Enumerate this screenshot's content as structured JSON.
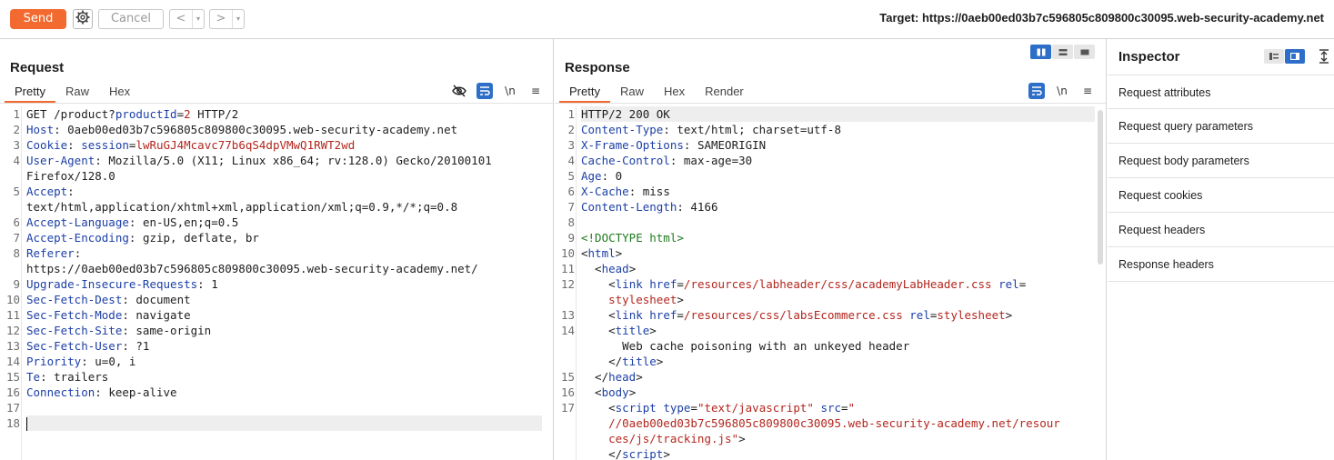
{
  "toolbar": {
    "send_label": "Send",
    "cancel_label": "Cancel",
    "back_label": "<",
    "forward_label": ">",
    "dropdown_glyph": "▾",
    "target_label": "Target: https://0aeb00ed03b7c596805c809800c30095.web-security-academy.net"
  },
  "colors": {
    "accent": "#f26a2f",
    "selected": "#2d6ec8",
    "header_key": "#1c3fa6",
    "string_value": "#b3261e",
    "doctype": "#1e7a1e"
  },
  "request": {
    "title": "Request",
    "tabs": [
      "Pretty",
      "Raw",
      "Hex"
    ],
    "active_tab": "Pretty",
    "icons": [
      "eye-off-icon",
      "wrap-lines-icon",
      "newline-icon",
      "menu-icon"
    ],
    "newline_glyph": "\\n",
    "menu_glyph": "≡",
    "lines": [
      {
        "n": "1",
        "segs": [
          {
            "t": "GET /product?",
            "c": "v"
          },
          {
            "t": "productId",
            "c": "k"
          },
          {
            "t": "=",
            "c": "v"
          },
          {
            "t": "2",
            "c": "r"
          },
          {
            "t": " HTTP/2",
            "c": "v"
          }
        ]
      },
      {
        "n": "2",
        "segs": [
          {
            "t": "Host",
            "c": "k"
          },
          {
            "t": ": 0aeb00ed03b7c596805c809800c30095.web-security-academy.net",
            "c": "v"
          }
        ]
      },
      {
        "n": "3",
        "segs": [
          {
            "t": "Cookie",
            "c": "k"
          },
          {
            "t": ": ",
            "c": "v"
          },
          {
            "t": "session",
            "c": "k"
          },
          {
            "t": "=",
            "c": "v"
          },
          {
            "t": "lwRuGJ4Mcavc77b6qS4dpVMwQ1RWT2wd",
            "c": "r"
          }
        ]
      },
      {
        "n": "4",
        "segs": [
          {
            "t": "User-Agent",
            "c": "k"
          },
          {
            "t": ": Mozilla/5.0 (X11; Linux x86_64; rv:128.0) Gecko/20100101",
            "c": "v"
          }
        ]
      },
      {
        "n": "",
        "segs": [
          {
            "t": "Firefox/128.0",
            "c": "v"
          }
        ]
      },
      {
        "n": "5",
        "segs": [
          {
            "t": "Accept",
            "c": "k"
          },
          {
            "t": ":",
            "c": "v"
          }
        ]
      },
      {
        "n": "",
        "segs": [
          {
            "t": "text/html,application/xhtml+xml,application/xml;q=0.9,*/*;q=0.8",
            "c": "v"
          }
        ]
      },
      {
        "n": "6",
        "segs": [
          {
            "t": "Accept-Language",
            "c": "k"
          },
          {
            "t": ": en-US,en;q=0.5",
            "c": "v"
          }
        ]
      },
      {
        "n": "7",
        "segs": [
          {
            "t": "Accept-Encoding",
            "c": "k"
          },
          {
            "t": ": gzip, deflate, br",
            "c": "v"
          }
        ]
      },
      {
        "n": "8",
        "segs": [
          {
            "t": "Referer",
            "c": "k"
          },
          {
            "t": ":",
            "c": "v"
          }
        ]
      },
      {
        "n": "",
        "segs": [
          {
            "t": "https://0aeb00ed03b7c596805c809800c30095.web-security-academy.net/",
            "c": "v"
          }
        ]
      },
      {
        "n": "9",
        "segs": [
          {
            "t": "Upgrade-Insecure-Requests",
            "c": "k"
          },
          {
            "t": ": 1",
            "c": "v"
          }
        ]
      },
      {
        "n": "10",
        "segs": [
          {
            "t": "Sec-Fetch-Dest",
            "c": "k"
          },
          {
            "t": ": document",
            "c": "v"
          }
        ]
      },
      {
        "n": "11",
        "segs": [
          {
            "t": "Sec-Fetch-Mode",
            "c": "k"
          },
          {
            "t": ": navigate",
            "c": "v"
          }
        ]
      },
      {
        "n": "12",
        "segs": [
          {
            "t": "Sec-Fetch-Site",
            "c": "k"
          },
          {
            "t": ": same-origin",
            "c": "v"
          }
        ]
      },
      {
        "n": "13",
        "segs": [
          {
            "t": "Sec-Fetch-User",
            "c": "k"
          },
          {
            "t": ": ?1",
            "c": "v"
          }
        ]
      },
      {
        "n": "14",
        "segs": [
          {
            "t": "Priority",
            "c": "k"
          },
          {
            "t": ": u=0, i",
            "c": "v"
          }
        ]
      },
      {
        "n": "15",
        "segs": [
          {
            "t": "Te",
            "c": "k"
          },
          {
            "t": ": trailers",
            "c": "v"
          }
        ]
      },
      {
        "n": "16",
        "segs": [
          {
            "t": "Connection",
            "c": "k"
          },
          {
            "t": ": keep-alive",
            "c": "v"
          }
        ]
      },
      {
        "n": "17",
        "segs": []
      },
      {
        "n": "18",
        "segs": [],
        "hl": true,
        "caret": true
      }
    ]
  },
  "response": {
    "title": "Response",
    "tabs": [
      "Pretty",
      "Raw",
      "Hex",
      "Render"
    ],
    "active_tab": "Pretty",
    "icons": [
      "wrap-lines-icon",
      "newline-icon",
      "menu-icon"
    ],
    "newline_glyph": "\\n",
    "menu_glyph": "≡",
    "lines": [
      {
        "n": "1",
        "segs": [
          {
            "t": "HTTP/2 200 OK",
            "c": "v"
          }
        ],
        "hl": true
      },
      {
        "n": "2",
        "segs": [
          {
            "t": "Content-Type",
            "c": "k"
          },
          {
            "t": ": text/html; charset=utf-8",
            "c": "v"
          }
        ]
      },
      {
        "n": "3",
        "segs": [
          {
            "t": "X-Frame-Options",
            "c": "k"
          },
          {
            "t": ": SAMEORIGIN",
            "c": "v"
          }
        ]
      },
      {
        "n": "4",
        "segs": [
          {
            "t": "Cache-Control",
            "c": "k"
          },
          {
            "t": ": max-age=30",
            "c": "v"
          }
        ]
      },
      {
        "n": "5",
        "segs": [
          {
            "t": "Age",
            "c": "k"
          },
          {
            "t": ": 0",
            "c": "v"
          }
        ]
      },
      {
        "n": "6",
        "segs": [
          {
            "t": "X-Cache",
            "c": "k"
          },
          {
            "t": ": miss",
            "c": "v"
          }
        ]
      },
      {
        "n": "7",
        "segs": [
          {
            "t": "Content-Length",
            "c": "k"
          },
          {
            "t": ": 4166",
            "c": "v"
          }
        ]
      },
      {
        "n": "8",
        "segs": []
      },
      {
        "n": "9",
        "segs": [
          {
            "t": "<!DOCTYPE html>",
            "c": "g"
          }
        ]
      },
      {
        "n": "10",
        "segs": [
          {
            "t": "<",
            "c": "v"
          },
          {
            "t": "html",
            "c": "k"
          },
          {
            "t": ">",
            "c": "v"
          }
        ]
      },
      {
        "n": "11",
        "segs": [
          {
            "t": "  <",
            "c": "v"
          },
          {
            "t": "head",
            "c": "k"
          },
          {
            "t": ">",
            "c": "v"
          }
        ]
      },
      {
        "n": "12",
        "segs": [
          {
            "t": "    <",
            "c": "v"
          },
          {
            "t": "link",
            "c": "k"
          },
          {
            "t": " ",
            "c": "v"
          },
          {
            "t": "href",
            "c": "k"
          },
          {
            "t": "=",
            "c": "v"
          },
          {
            "t": "/resources/labheader/css/academyLabHeader.css",
            "c": "r"
          },
          {
            "t": " ",
            "c": "v"
          },
          {
            "t": "rel",
            "c": "k"
          },
          {
            "t": "=",
            "c": "v"
          }
        ]
      },
      {
        "n": "",
        "segs": [
          {
            "t": "    ",
            "c": "v"
          },
          {
            "t": "stylesheet",
            "c": "r"
          },
          {
            "t": ">",
            "c": "v"
          }
        ]
      },
      {
        "n": "13",
        "segs": [
          {
            "t": "    <",
            "c": "v"
          },
          {
            "t": "link",
            "c": "k"
          },
          {
            "t": " ",
            "c": "v"
          },
          {
            "t": "href",
            "c": "k"
          },
          {
            "t": "=",
            "c": "v"
          },
          {
            "t": "/resources/css/labsEcommerce.css",
            "c": "r"
          },
          {
            "t": " ",
            "c": "v"
          },
          {
            "t": "rel",
            "c": "k"
          },
          {
            "t": "=",
            "c": "v"
          },
          {
            "t": "stylesheet",
            "c": "r"
          },
          {
            "t": ">",
            "c": "v"
          }
        ]
      },
      {
        "n": "14",
        "segs": [
          {
            "t": "    <",
            "c": "v"
          },
          {
            "t": "title",
            "c": "k"
          },
          {
            "t": ">",
            "c": "v"
          }
        ]
      },
      {
        "n": "",
        "segs": [
          {
            "t": "      Web cache poisoning with an unkeyed header",
            "c": "v"
          }
        ]
      },
      {
        "n": "",
        "segs": [
          {
            "t": "    </",
            "c": "v"
          },
          {
            "t": "title",
            "c": "k"
          },
          {
            "t": ">",
            "c": "v"
          }
        ]
      },
      {
        "n": "15",
        "segs": [
          {
            "t": "  </",
            "c": "v"
          },
          {
            "t": "head",
            "c": "k"
          },
          {
            "t": ">",
            "c": "v"
          }
        ]
      },
      {
        "n": "16",
        "segs": [
          {
            "t": "  <",
            "c": "v"
          },
          {
            "t": "body",
            "c": "k"
          },
          {
            "t": ">",
            "c": "v"
          }
        ]
      },
      {
        "n": "17",
        "segs": [
          {
            "t": "    <",
            "c": "v"
          },
          {
            "t": "script",
            "c": "k"
          },
          {
            "t": " ",
            "c": "v"
          },
          {
            "t": "type",
            "c": "k"
          },
          {
            "t": "=",
            "c": "v"
          },
          {
            "t": "\"text/javascript\"",
            "c": "r"
          },
          {
            "t": " ",
            "c": "v"
          },
          {
            "t": "src",
            "c": "k"
          },
          {
            "t": "=",
            "c": "v"
          },
          {
            "t": "\"",
            "c": "r"
          }
        ]
      },
      {
        "n": "",
        "segs": [
          {
            "t": "    //0aeb00ed03b7c596805c809800c30095.web-security-academy.net/resour",
            "c": "r"
          }
        ]
      },
      {
        "n": "",
        "segs": [
          {
            "t": "    ces/js/tracking.js\"",
            "c": "r"
          },
          {
            "t": ">",
            "c": "v"
          }
        ]
      },
      {
        "n": "",
        "segs": [
          {
            "t": "    </",
            "c": "v"
          },
          {
            "t": "script",
            "c": "k"
          },
          {
            "t": ">",
            "c": "v"
          }
        ]
      }
    ]
  },
  "inspector": {
    "title": "Inspector",
    "items": [
      "Request attributes",
      "Request query parameters",
      "Request body parameters",
      "Request cookies",
      "Request headers",
      "Response headers"
    ]
  }
}
